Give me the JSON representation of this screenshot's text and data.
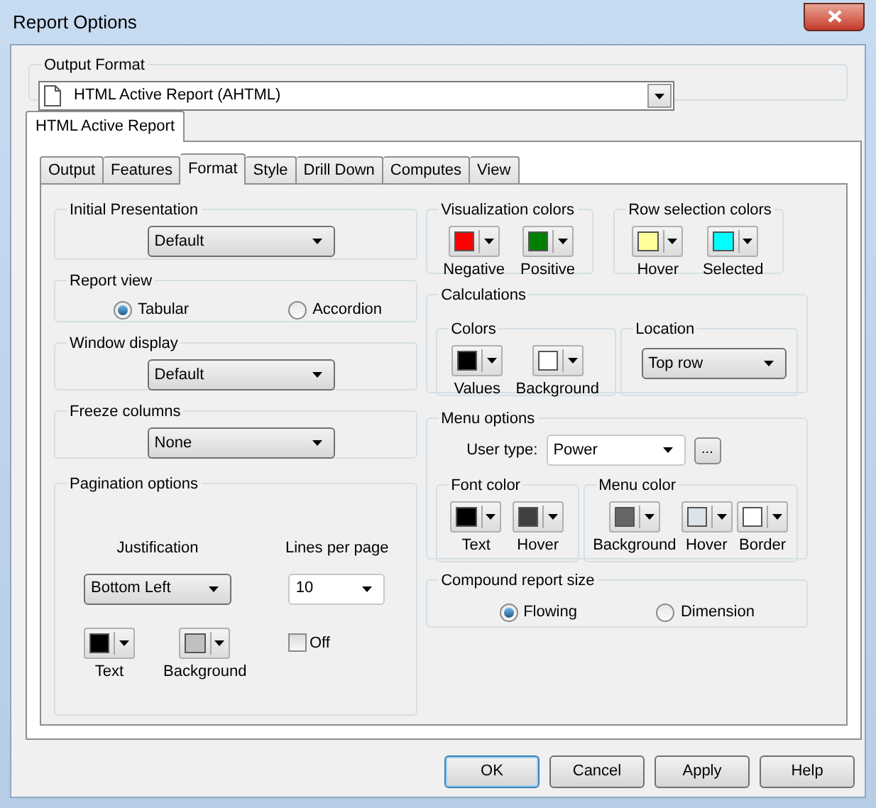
{
  "window": {
    "title": "Report Options"
  },
  "output_format": {
    "label": "Output Format",
    "value": "HTML Active Report (AHTML)"
  },
  "outer_tabs": [
    {
      "label": "HTML Active Report",
      "selected": true
    }
  ],
  "tabs": [
    {
      "label": "Output",
      "selected": false
    },
    {
      "label": "Features",
      "selected": false
    },
    {
      "label": "Format",
      "selected": true
    },
    {
      "label": "Style",
      "selected": false
    },
    {
      "label": "Drill Down",
      "selected": false
    },
    {
      "label": "Computes",
      "selected": false
    },
    {
      "label": "View",
      "selected": false
    }
  ],
  "initial_presentation": {
    "label": "Initial Presentation",
    "value": "Default"
  },
  "report_view": {
    "label": "Report view",
    "options": [
      {
        "label": "Tabular",
        "selected": true
      },
      {
        "label": "Accordion",
        "selected": false
      }
    ]
  },
  "window_display": {
    "label": "Window display",
    "value": "Default"
  },
  "freeze_columns": {
    "label": "Freeze columns",
    "value": "None"
  },
  "pagination": {
    "label": "Pagination options",
    "justification": {
      "label": "Justification",
      "value": "Bottom Left"
    },
    "lines_per_page": {
      "label": "Lines per page",
      "value": "10"
    },
    "colors": [
      {
        "label": "Text",
        "color": "#000000"
      },
      {
        "label": "Background",
        "color": "#c0c0c0"
      }
    ],
    "off": {
      "label": "Off",
      "checked": false
    }
  },
  "visualization_colors": {
    "label": "Visualization colors",
    "colors": [
      {
        "label": "Negative",
        "color": "#ff0000"
      },
      {
        "label": "Positive",
        "color": "#008000"
      }
    ]
  },
  "row_selection_colors": {
    "label": "Row selection colors",
    "colors": [
      {
        "label": "Hover",
        "color": "#ffff99"
      },
      {
        "label": "Selected",
        "color": "#00ffff"
      }
    ]
  },
  "calculations": {
    "label": "Calculations",
    "colors": {
      "label": "Colors",
      "items": [
        {
          "label": "Values",
          "color": "#000000"
        },
        {
          "label": "Background",
          "color": "#ffffff"
        }
      ]
    },
    "location": {
      "label": "Location",
      "value": "Top row"
    }
  },
  "menu_options": {
    "label": "Menu options",
    "user_type": {
      "label": "User type:",
      "value": "Power",
      "button": "..."
    },
    "font_color": {
      "label": "Font color",
      "items": [
        {
          "label": "Text",
          "color": "#000000"
        },
        {
          "label": "Hover",
          "color": "#404040"
        }
      ]
    },
    "menu_color": {
      "label": "Menu color",
      "items": [
        {
          "label": "Background",
          "color": "#666666"
        },
        {
          "label": "Hover",
          "color": "#dde3ea"
        },
        {
          "label": "Border",
          "color": "#ffffff"
        }
      ]
    }
  },
  "compound_report_size": {
    "label": "Compound report size",
    "options": [
      {
        "label": "Flowing",
        "selected": true
      },
      {
        "label": "Dimension",
        "selected": false
      }
    ]
  },
  "buttons": [
    {
      "label": "OK",
      "default": true
    },
    {
      "label": "Cancel",
      "default": false
    },
    {
      "label": "Apply",
      "default": false
    },
    {
      "label": "Help",
      "default": false
    }
  ]
}
